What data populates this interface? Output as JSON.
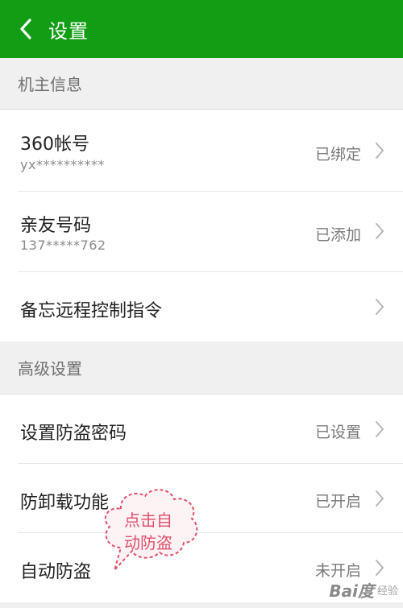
{
  "header": {
    "title": "设置"
  },
  "sections": [
    {
      "title": "机主信息"
    },
    {
      "title": "高级设置"
    }
  ],
  "rows": {
    "account": {
      "label": "360帐号",
      "sub": "yx**********",
      "status": "已绑定"
    },
    "family": {
      "label": "亲友号码",
      "sub": "137*****762",
      "status": "已添加"
    },
    "remote": {
      "label": "备忘远程控制指令",
      "status": ""
    },
    "password": {
      "label": "设置防盗密码",
      "status": "已设置"
    },
    "uninstall": {
      "label": "防卸载功能",
      "status": "已开启"
    },
    "auto": {
      "label": "自动防盗",
      "status": "未开启"
    }
  },
  "annotation": {
    "line1": "点击自",
    "line2": "动防盗"
  },
  "watermark": {
    "brand": "Bai度",
    "sub": "经验"
  },
  "colors": {
    "header": "#129e14",
    "annotation": "#e0506a"
  },
  "icons": {
    "back": "chevron-left-icon",
    "row": "chevron-right-icon"
  }
}
